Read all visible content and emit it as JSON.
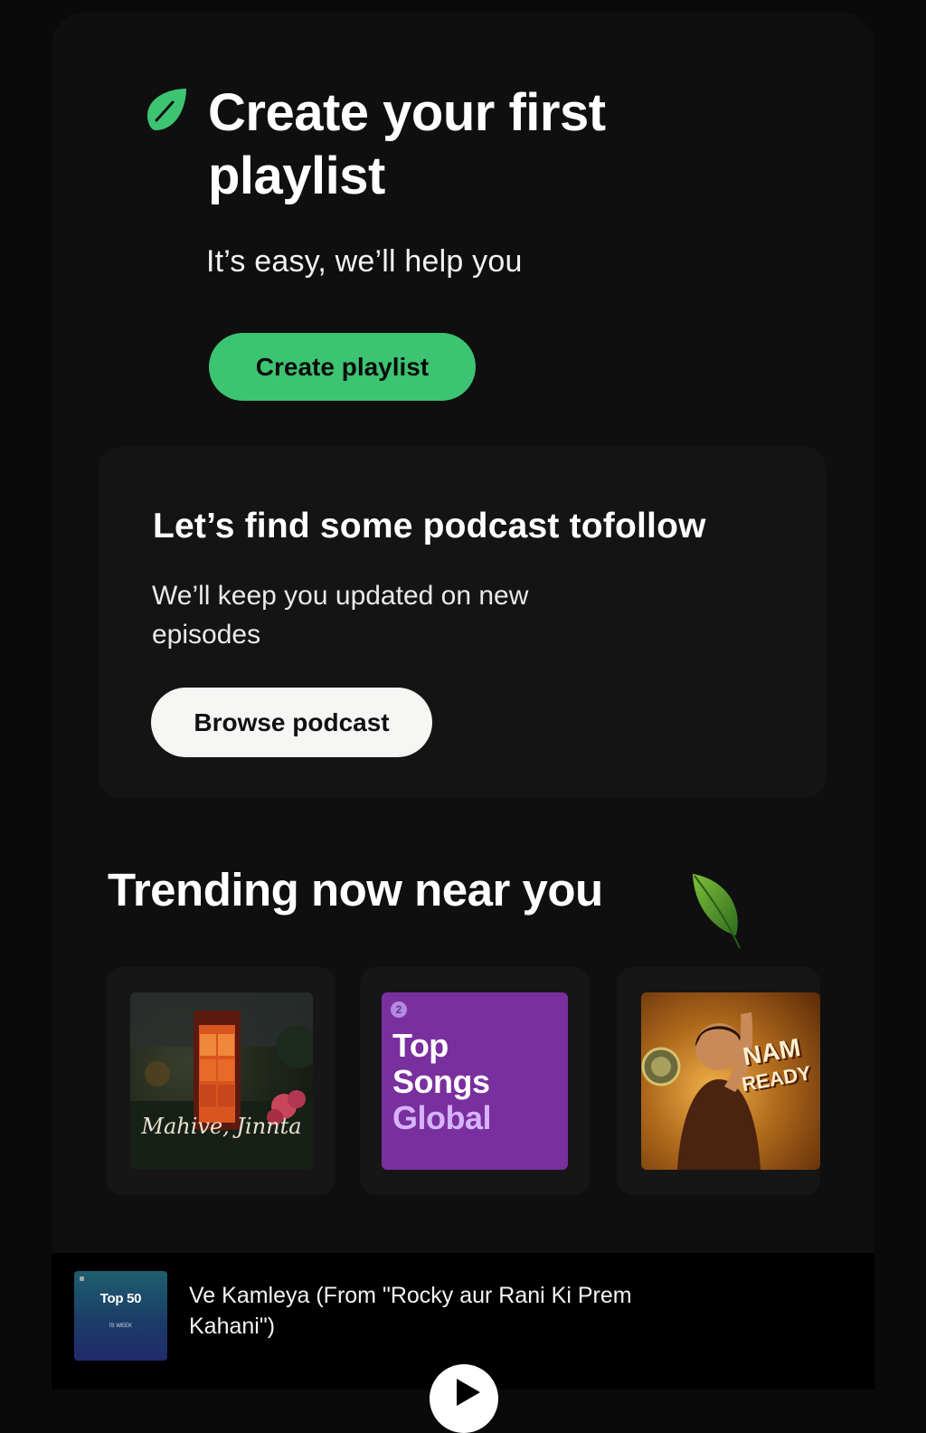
{
  "hero": {
    "title": "Create your first playlist",
    "subtitle": "It’s easy, we’ll help you",
    "button_label": "Create playlist",
    "icon": "pencil-icon",
    "accent_color": "#3dc472"
  },
  "podcast_card": {
    "title": "Let’s find some podcast tofollow",
    "description": "We’ll keep you updated on new episodes",
    "button_label": "Browse podcast"
  },
  "trending": {
    "title": "Trending now near you",
    "icon": "leaf-icon",
    "cards": [
      {
        "art_text": "Mahive, Jinnta"
      },
      {
        "rank": "2",
        "lines": [
          "Top",
          "Songs",
          "Global"
        ]
      },
      {
        "art_lines": [
          "NAM",
          "READY"
        ]
      }
    ]
  },
  "now_playing": {
    "thumb_title": "Top 50",
    "thumb_subtitle": "İS WEEK",
    "track": "Ve Kamleya (From \"Rocky aur Rani Ki Prem Kahani\")",
    "play_icon": "play-icon"
  }
}
